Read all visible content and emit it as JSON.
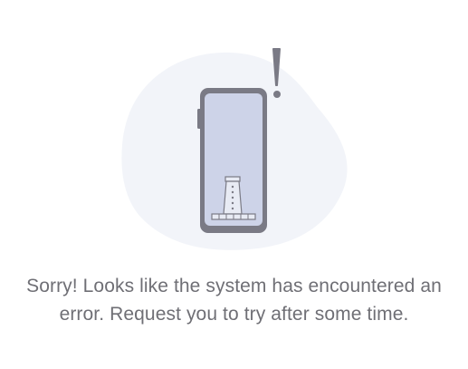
{
  "error": {
    "message_line1": "Sorry! Looks like the system has encountered an",
    "message_line2": "error. Request you to try after some time."
  },
  "illustration": {
    "icon": "phone-with-exclamation",
    "colors": {
      "blob": "#f2f4f9",
      "phone_frame": "#7a7a85",
      "phone_screen": "#cdd3e8",
      "tower": "#e8ebf4",
      "exclamation": "#7a7a85"
    }
  }
}
